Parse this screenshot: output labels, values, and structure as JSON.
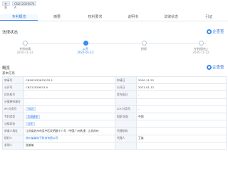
{
  "header": {
    "app_tag": "专利",
    "number_tag": "CN212029074 A"
  },
  "tabs": [
    {
      "label": "专利概览",
      "active": true
    },
    {
      "label": "摘要",
      "active": false
    },
    {
      "label": "权利要求",
      "active": false
    },
    {
      "label": "说明书",
      "active": false
    },
    {
      "label": "法律状态",
      "active": false
    },
    {
      "label": "引证",
      "active": false
    }
  ],
  "timeline_section": {
    "title": "法律状态",
    "brand": "企查查",
    "steps": [
      {
        "label": "专利申请",
        "date": "2020-11-22",
        "active": false
      },
      {
        "label": "公开",
        "date": "2021-01-12",
        "active": true
      },
      {
        "label": "授权",
        "date": "",
        "active": false
      },
      {
        "label": "专利权终止",
        "date": "2045-11-22",
        "active": false
      }
    ]
  },
  "overview_section": {
    "title": "概览",
    "brand": "企查查",
    "subtitle": "基本信息"
  },
  "table": {
    "rows": [
      [
        {
          "k": "申请号",
          "v": "CN202022670532.1"
        },
        {
          "k": "申请日",
          "v": "2020-11-22"
        }
      ],
      [
        {
          "k": "公开号",
          "v": "CN212029074 A"
        },
        {
          "k": "公开日",
          "v": "2021-01-12"
        }
      ],
      [
        {
          "k": "优先权号",
          "v": "-"
        },
        {
          "k": "优先权日",
          "v": "-"
        }
      ],
      [
        {
          "k": "分案原申请号",
          "v": "-"
        },
        {
          "k": "",
          "v": ""
        }
      ],
      [
        {
          "k": "IPC分类号",
          "v": "H02J"
        },
        {
          "k": "LOC分类号",
          "v": "-"
        }
      ],
      [
        {
          "k": "专利类型",
          "v": "实用新型"
        },
        {
          "k": "国家/地区",
          "v": "中国"
        }
      ],
      [
        {
          "k": "法律状态",
          "v": "公开"
        },
        {
          "k": "",
          "v": ""
        }
      ],
      [
        {
          "k": "申请人地址",
          "v": "江苏省苏州市吴中区发明路十八号（中国广州热线）江苏苏州"
        },
        {
          "k": "代理机构",
          "v": ""
        }
      ],
      [
        {
          "k": "权利人",
          "v": "苏州某某电子科技有限公司"
        },
        {
          "k": "代理人",
          "v": "王某"
        }
      ],
      [
        {
          "k": "发明人",
          "v": "张某某"
        },
        {
          "k": "",
          "v": ""
        }
      ]
    ]
  }
}
